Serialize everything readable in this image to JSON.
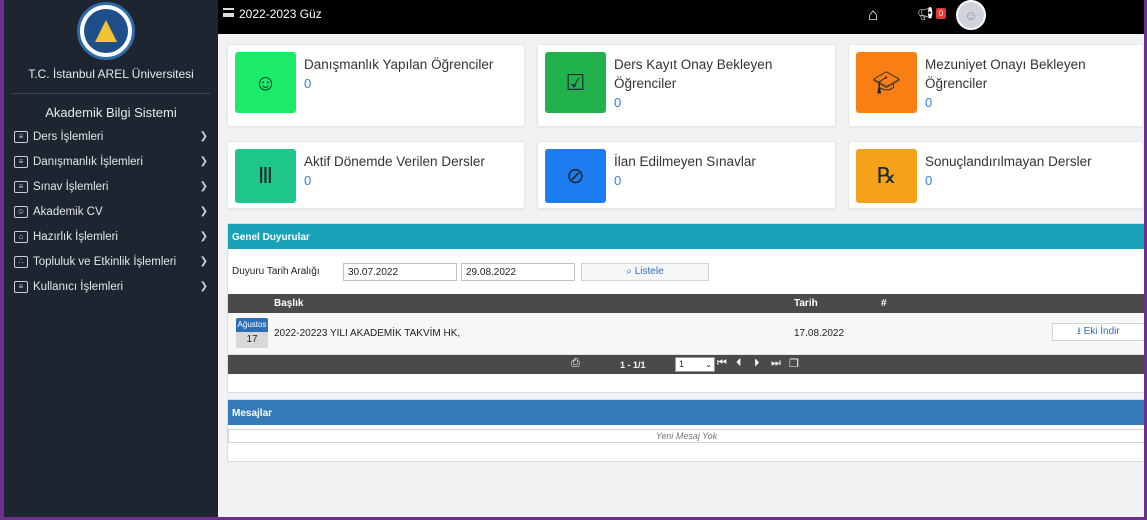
{
  "sidebar": {
    "university": "T.C. İstanbul AREL Üniversitesi",
    "system_title": "Akademik Bilgi Sistemi",
    "items": [
      {
        "label": "Ders İşlemleri",
        "icon": "list-icon"
      },
      {
        "label": "Danışmanlık İşlemleri",
        "icon": "list-icon"
      },
      {
        "label": "Sınav İşlemleri",
        "icon": "document-icon"
      },
      {
        "label": "Akademik CV",
        "icon": "id-card-icon"
      },
      {
        "label": "Hazırlık İşlemleri",
        "icon": "building-icon"
      },
      {
        "label": "Topluluk ve Etkinlik İşlemleri",
        "icon": "group-icon"
      },
      {
        "label": "Kullanıcı İşlemleri",
        "icon": "user-list-icon"
      }
    ]
  },
  "topbar": {
    "term": "2022-2023 Güz",
    "notif_count": "0"
  },
  "cards": [
    {
      "title": "Danışmanlık Yapılan Öğrenciler",
      "value": "0",
      "color": "#1bea6b",
      "icon": "students-icon"
    },
    {
      "title": "Ders Kayıt Onay Bekleyen Öğrenciler",
      "value": "0",
      "color": "#22b24c",
      "icon": "clipboard-check-icon"
    },
    {
      "title": "Mezuniyet Onayı Bekleyen Öğrenciler",
      "value": "0",
      "color": "#f97f14",
      "icon": "graduation-cap-icon"
    },
    {
      "title": "Aktif Dönemde Verilen Dersler",
      "value": "0",
      "color": "#1fc88a",
      "icon": "books-icon"
    },
    {
      "title": "İlan Edilmeyen Sınavlar",
      "value": "0",
      "color": "#1d7cf2",
      "icon": "no-exam-icon"
    },
    {
      "title": "Sonuçlandırılmayan Dersler",
      "value": "0",
      "color": "#f5a11a",
      "icon": "prescription-clipboard-icon"
    }
  ],
  "announcements": {
    "header": "Genel Duyurular",
    "range_label": "Duyuru Tarih Aralığı",
    "start_date": "30.07.2022",
    "end_date": "29.08.2022",
    "list_button": "Listele",
    "columns": {
      "title": "Başlık",
      "date": "Tarih",
      "hash": "#"
    },
    "rows": [
      {
        "month": "Ağustos",
        "day": "17",
        "title": "2022-20223 YILI AKADEMİK TAKVİM HK,",
        "date": "17.08.2022",
        "action": "Eki İndir"
      }
    ],
    "pager": {
      "info": "1 - 1/1",
      "page": "1"
    }
  },
  "messages": {
    "header": "Mesajlar",
    "empty": "Yeni Mesaj Yok"
  }
}
